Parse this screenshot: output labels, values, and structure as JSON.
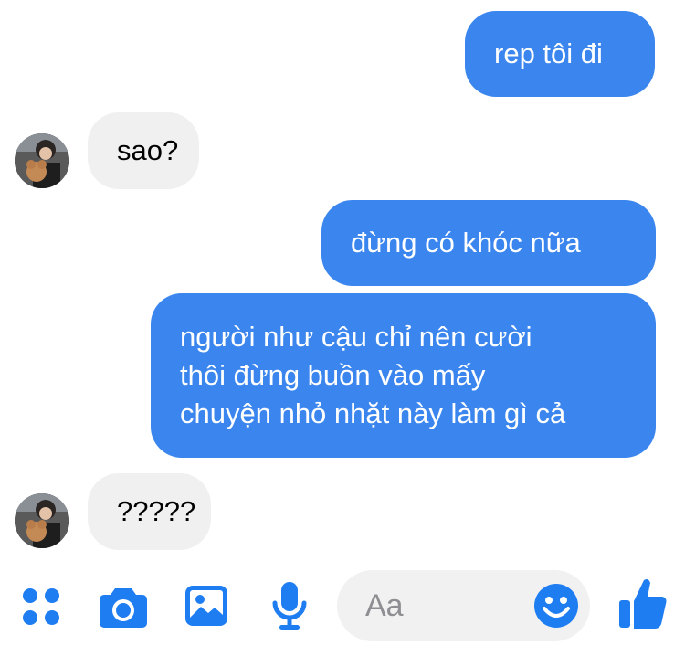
{
  "messages": [
    {
      "direction": "outgoing",
      "text": "rep tôi đi"
    },
    {
      "direction": "incoming",
      "text": "sao?"
    },
    {
      "direction": "outgoing",
      "text": "đừng có khóc nữa"
    },
    {
      "direction": "outgoing",
      "text": "người như cậu chỉ nên cười\nthôi đừng buồn vào mấy\nchuyện nhỏ nhặt này làm gì cả"
    },
    {
      "direction": "incoming",
      "text": "?????"
    }
  ],
  "composer": {
    "placeholder": "Aa",
    "icons": [
      "apps-icon",
      "camera-icon",
      "image-icon",
      "microphone-icon",
      "emoji-icon",
      "like-icon"
    ]
  },
  "colors": {
    "outgoing_bubble": "#3b86ee",
    "incoming_bubble": "#f0f0f0",
    "accent": "#1f7df2"
  }
}
